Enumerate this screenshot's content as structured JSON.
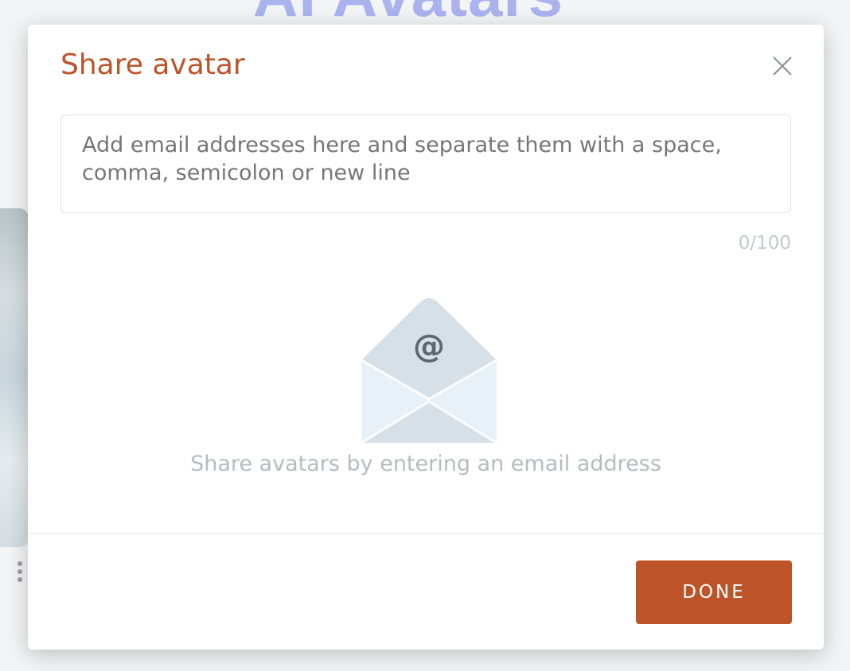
{
  "background": {
    "heading": "AI Avatars"
  },
  "modal": {
    "title": "Share avatar",
    "email_input": {
      "value": "",
      "placeholder": "Add email addresses here and separate them with a space, comma, semicolon or new line"
    },
    "counter": "0/100",
    "empty_state": {
      "icon": "envelope-at-icon",
      "at_symbol": "@",
      "text": "Share avatars by entering an email address"
    },
    "done_label": "DONE"
  },
  "colors": {
    "accent": "#bd5429",
    "title": "#bd5429",
    "muted_text": "#b7bac0",
    "envelope_dark": "#d6e0e6",
    "envelope_light": "#e8f1f7"
  }
}
